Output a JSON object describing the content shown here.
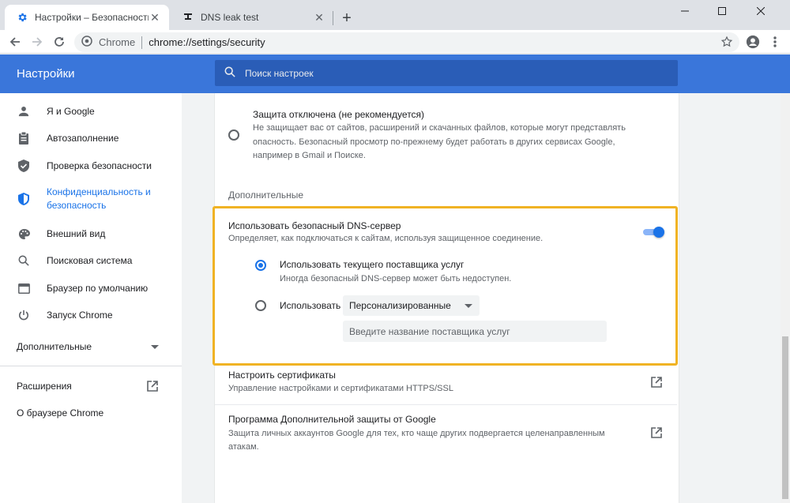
{
  "tabs": [
    {
      "title": "Настройки – Безопасность"
    },
    {
      "title": "DNS leak test"
    }
  ],
  "omnibox": {
    "site": "Chrome",
    "url": "chrome://settings/security"
  },
  "header": {
    "title": "Настройки",
    "search_placeholder": "Поиск настроек"
  },
  "sidebar": {
    "items": [
      {
        "label": "Я и Google",
        "icon": "person-icon"
      },
      {
        "label": "Автозаполнение",
        "icon": "clipboard-icon"
      },
      {
        "label": "Проверка безопасности",
        "icon": "shield-icon"
      },
      {
        "label": "Конфиденциальность и безопасность",
        "icon": "shield-lock-icon",
        "active": true
      },
      {
        "label": "Внешний вид",
        "icon": "palette-icon"
      },
      {
        "label": "Поисковая система",
        "icon": "search-icon"
      },
      {
        "label": "Браузер по умолчанию",
        "icon": "browser-icon"
      },
      {
        "label": "Запуск Chrome",
        "icon": "power-icon"
      }
    ],
    "advanced_label": "Дополнительные",
    "extensions_label": "Расширения",
    "about_label": "О браузере Chrome"
  },
  "main": {
    "protection_off": {
      "title": "Защита отключена (не рекомендуется)",
      "line1": "Не защищает вас от сайтов, расширений и скачанных файлов, которые могут представлять",
      "line2": "опасность. Безопасный просмотр по-прежнему будет работать в других сервисах Google,",
      "line3": "например в Gmail и Поиске."
    },
    "section_advanced": "Дополнительные",
    "dns": {
      "title": "Использовать безопасный DNS-сервер",
      "subtitle": "Определяет, как подключаться к сайтам, используя защищенное соединение.",
      "option_current_title": "Использовать текущего поставщика услуг",
      "option_current_sub": "Иногда безопасный DNS-сервер может быть недоступен.",
      "option_custom_label": "Использовать",
      "custom_select_value": "Персонализированные",
      "provider_placeholder": "Введите название поставщика услуг",
      "enabled": true
    },
    "certificates": {
      "title": "Настроить сертификаты",
      "subtitle": "Управление настройками и сертификатами HTTPS/SSL"
    },
    "advanced_protection": {
      "title": "Программа Дополнительной защиты от Google",
      "line1": "Защита личных аккаунтов Google для тех, кто чаще других подвергается целенаправленным",
      "line2": "атакам."
    }
  },
  "colors": {
    "accent": "#1a73e8",
    "header": "#3a76da",
    "highlight": "#f0b324"
  }
}
